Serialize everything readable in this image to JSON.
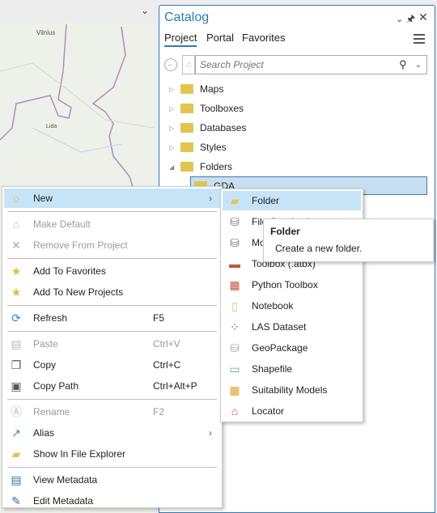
{
  "map": {
    "labels": [
      "Vilnius",
      "Lida"
    ]
  },
  "catalog": {
    "title": "Catalog",
    "tabs": [
      "Project",
      "Portal",
      "Favorites"
    ],
    "search_placeholder": "Search Project",
    "tree": [
      {
        "label": "Maps",
        "icon": "maps-folder-icon",
        "expanded": false
      },
      {
        "label": "Toolboxes",
        "icon": "toolbox-folder-icon",
        "expanded": false
      },
      {
        "label": "Databases",
        "icon": "database-folder-icon",
        "expanded": false
      },
      {
        "label": "Styles",
        "icon": "styles-folder-icon",
        "expanded": false
      },
      {
        "label": "Folders",
        "icon": "folder-icon",
        "expanded": true
      }
    ],
    "selected_item": "GDA"
  },
  "context_menu": {
    "items": [
      {
        "label": "New",
        "icon": "new-icon",
        "submenu": true,
        "highlight": true
      },
      {
        "sep": true
      },
      {
        "label": "Make Default",
        "icon": "home-icon",
        "disabled": true
      },
      {
        "label": "Remove From Project",
        "icon": "remove-icon",
        "disabled": true
      },
      {
        "sep": true
      },
      {
        "label": "Add To Favorites",
        "icon": "star-icon"
      },
      {
        "label": "Add To New Projects",
        "icon": "star-pin-icon"
      },
      {
        "sep": true
      },
      {
        "label": "Refresh",
        "icon": "refresh-icon",
        "shortcut": "F5"
      },
      {
        "sep": true
      },
      {
        "label": "Paste",
        "icon": "paste-icon",
        "shortcut": "Ctrl+V",
        "disabled": true
      },
      {
        "label": "Copy",
        "icon": "copy-icon",
        "shortcut": "Ctrl+C"
      },
      {
        "label": "Copy Path",
        "icon": "copy-path-icon",
        "shortcut": "Ctrl+Alt+P"
      },
      {
        "sep": true
      },
      {
        "label": "Rename",
        "icon": "rename-icon",
        "shortcut": "F2",
        "disabled": true
      },
      {
        "label": "Alias",
        "icon": "alias-icon",
        "submenu": true
      },
      {
        "label": "Show In File Explorer",
        "icon": "open-folder-icon"
      },
      {
        "sep": true
      },
      {
        "label": "View Metadata",
        "icon": "metadata-icon"
      },
      {
        "label": "Edit Metadata",
        "icon": "pencil-icon"
      }
    ]
  },
  "submenu": {
    "items": [
      {
        "label": "Folder",
        "icon": "new-folder-icon",
        "highlight": true
      },
      {
        "label": "File Geodatabase",
        "icon": "geodatabase-icon"
      },
      {
        "label": "Mobile Geodatabase",
        "icon": "mobile-geodatabase-icon"
      },
      {
        "label": "Toolbox (.atbx)",
        "icon": "toolbox-icon"
      },
      {
        "label": "Python Toolbox",
        "icon": "python-toolbox-icon"
      },
      {
        "label": "Notebook",
        "icon": "notebook-icon"
      },
      {
        "label": "LAS Dataset",
        "icon": "las-dataset-icon"
      },
      {
        "label": "GeoPackage",
        "icon": "geopackage-icon"
      },
      {
        "label": "Shapefile",
        "icon": "shapefile-icon"
      },
      {
        "label": "Suitability Models",
        "icon": "suitability-models-icon"
      },
      {
        "label": "Locator",
        "icon": "locator-icon"
      }
    ]
  },
  "tooltip": {
    "title": "Folder",
    "text": "Create a new folder."
  }
}
